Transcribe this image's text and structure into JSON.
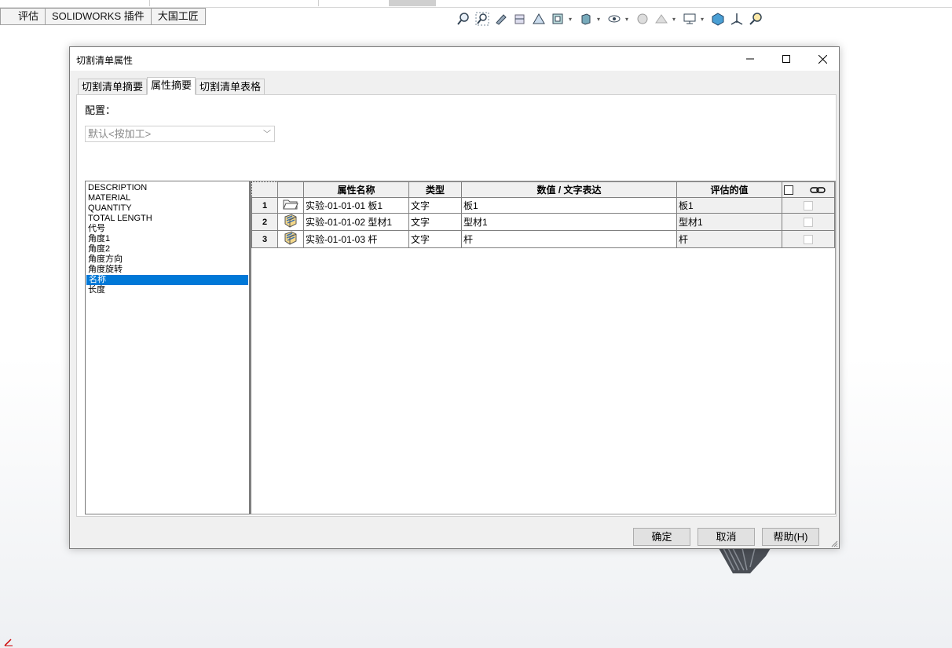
{
  "command_manager": {
    "tabs": [
      {
        "label": "评估"
      },
      {
        "label": "SOLIDWORKS 插件"
      },
      {
        "label": "大国工匠"
      }
    ]
  },
  "heads_up_icons": [
    "zoom-to-fit-icon",
    "zoom-to-area-icon",
    "previous-view-icon",
    "section-view-icon",
    "dynamic-annotation-icon",
    "view-orientation-icon",
    "display-style-icon",
    "hide-show-icon",
    "edit-appearance-icon",
    "apply-scene-icon",
    "view-settings-icon",
    "3d-view-icon",
    "apply-align-icon",
    "zoom-tool-icon"
  ],
  "dialog": {
    "title": "切割清单属性",
    "tabs": [
      {
        "label": "切割清单摘要",
        "active": false
      },
      {
        "label": "属性摘要",
        "active": true
      },
      {
        "label": "切割清单表格",
        "active": false
      }
    ],
    "config_label": "配置：",
    "config_value": "默认<按加工>",
    "property_list": [
      "DESCRIPTION",
      "MATERIAL",
      "QUANTITY",
      "TOTAL LENGTH",
      "代号",
      "角度1",
      "角度2",
      "角度方向",
      "角度旋转",
      "名称",
      "长度"
    ],
    "selected_property": "名称",
    "table": {
      "headers": {
        "name": "属性名称",
        "type": "类型",
        "value": "数值 / 文字表达",
        "evaluated": "评估的值"
      },
      "rows": [
        {
          "num": "1",
          "icon": "folder-icon",
          "name": "实验-01-01-01 板1",
          "type": "文字",
          "value": "板1",
          "evaluated": "板1"
        },
        {
          "num": "2",
          "icon": "weldment-body-icon",
          "name": "实验-01-01-02 型材1",
          "type": "文字",
          "value": "型材1",
          "evaluated": "型材1"
        },
        {
          "num": "3",
          "icon": "weldment-body-icon",
          "name": "实验-01-01-03 杆",
          "type": "文字",
          "value": "杆",
          "evaluated": "杆"
        }
      ]
    },
    "buttons": {
      "ok": "确定",
      "cancel": "取消",
      "help": "帮助(H)"
    }
  },
  "colors": {
    "selection": "#0078d7",
    "dialog_bg": "#f0f0f0"
  }
}
